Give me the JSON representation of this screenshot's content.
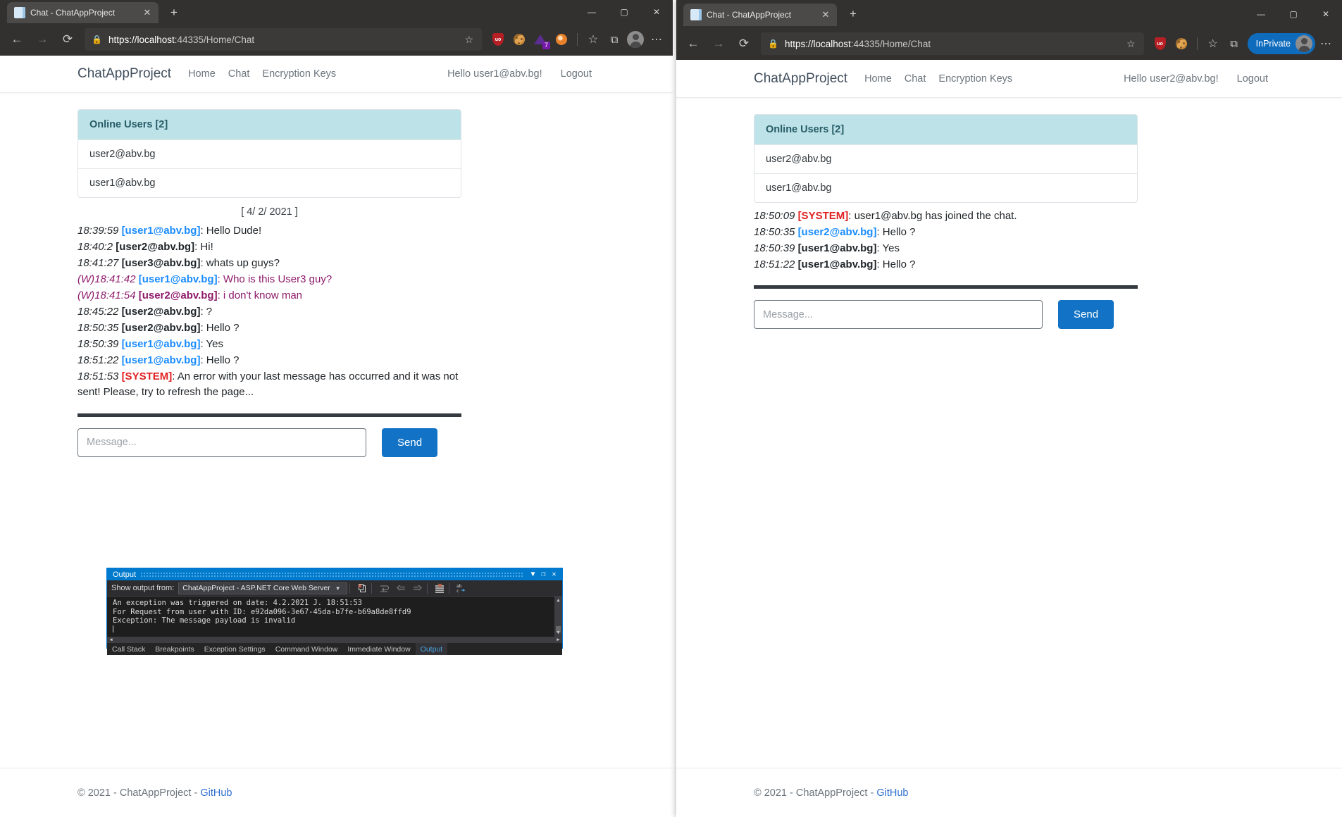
{
  "windows": {
    "left": {
      "tab_title": "Chat - ChatAppProject",
      "url_host": "https://localhost",
      "url_path": ":44335/Home/Chat",
      "extensions": [
        "ublock-shield-icon",
        "cookie-icon",
        "purple-extension-icon",
        "orange-extension-icon"
      ],
      "purple_badge": "7",
      "nav": {
        "brand": "ChatAppProject",
        "links": [
          "Home",
          "Chat",
          "Encryption Keys"
        ],
        "greeting": "Hello user1@abv.bg!",
        "logout": "Logout"
      },
      "online_users": {
        "header": "Online Users [2]",
        "rows": [
          "user2@abv.bg",
          "user1@abv.bg"
        ]
      },
      "datestamp": "[ 4/ 2/ 2021 ]",
      "messages": [
        {
          "prefix": "",
          "time": "18:39:59",
          "user": "[user1@abv.bg]",
          "text": ": Hello Dude!",
          "kind": "self"
        },
        {
          "prefix": "",
          "time": "18:40:2",
          "user": "[user2@abv.bg]",
          "text": ": Hi!",
          "kind": "other"
        },
        {
          "prefix": "",
          "time": "18:41:27",
          "user": "[user3@abv.bg]",
          "text": ": whats up guys?",
          "kind": "other"
        },
        {
          "prefix": "(W)",
          "time": "18:41:42",
          "user": "[user1@abv.bg]",
          "text": ": Who is this User3 guy?",
          "kind": "whisper-self"
        },
        {
          "prefix": "(W)",
          "time": "18:41:54",
          "user": "[user2@abv.bg]",
          "text": ": i don't know man",
          "kind": "whisper"
        },
        {
          "prefix": "",
          "time": "18:45:22",
          "user": "[user2@abv.bg]",
          "text": ": ?",
          "kind": "other"
        },
        {
          "prefix": "",
          "time": "18:50:35",
          "user": "[user2@abv.bg]",
          "text": ": Hello ?",
          "kind": "other"
        },
        {
          "prefix": "",
          "time": "18:50:39",
          "user": "[user1@abv.bg]",
          "text": ": Yes",
          "kind": "self"
        },
        {
          "prefix": "",
          "time": "18:51:22",
          "user": "[user1@abv.bg]",
          "text": ": Hello ?",
          "kind": "self"
        },
        {
          "prefix": "",
          "time": "18:51:53",
          "user": "[SYSTEM]",
          "text": ": An error with your last message has occurred and it was not sent! Please, try to refresh the page...",
          "kind": "system"
        }
      ],
      "composer": {
        "placeholder": "Message...",
        "value": "",
        "send_label": "Send"
      },
      "footer": {
        "copyright": "© 2021 - ChatAppProject - ",
        "link": "GitHub"
      }
    },
    "right": {
      "tab_title": "Chat - ChatAppProject",
      "url_host": "https://localhost",
      "url_path": ":44335/Home/Chat",
      "extensions": [
        "ublock-shield-icon",
        "cookie-icon"
      ],
      "inprivate_label": "InPrivate",
      "nav": {
        "brand": "ChatAppProject",
        "links": [
          "Home",
          "Chat",
          "Encryption Keys"
        ],
        "greeting": "Hello user2@abv.bg!",
        "logout": "Logout"
      },
      "online_users": {
        "header": "Online Users [2]",
        "rows": [
          "user2@abv.bg",
          "user1@abv.bg"
        ]
      },
      "messages": [
        {
          "prefix": "",
          "time": "18:50:09",
          "user": "[SYSTEM]",
          "text": ": user1@abv.bg has joined the chat.",
          "kind": "system"
        },
        {
          "prefix": "",
          "time": "18:50:35",
          "user": "[user2@abv.bg]",
          "text": ": Hello ?",
          "kind": "self"
        },
        {
          "prefix": "",
          "time": "18:50:39",
          "user": "[user1@abv.bg]",
          "text": ": Yes",
          "kind": "other"
        },
        {
          "prefix": "",
          "time": "18:51:22",
          "user": "[user1@abv.bg]",
          "text": ": Hello ?",
          "kind": "other"
        }
      ],
      "composer": {
        "placeholder": "Message...",
        "value": "",
        "send_label": "Send"
      },
      "footer": {
        "copyright": "© 2021 - ChatAppProject - ",
        "link": "GitHub"
      }
    }
  },
  "output_panel": {
    "title": "Output",
    "show_output_from_label": "Show output from:",
    "selected_source": "ChatAppProject - ASP.NET Core Web Server",
    "toolbar_icons": [
      "clear-all-icon",
      "toggle-wordwrap-icon",
      "navigate-back-icon",
      "navigate-forward-icon",
      "clear-pane-icon",
      "find-icon"
    ],
    "lines": [
      "An exception was triggered on date: 4.2.2021 J. 18:51:53",
      "For Request from user with ID: e92da096-3e67-45da-b7fe-b69a8de8ffd9",
      "Exception: The message payload is invalid"
    ],
    "tabs": [
      "Call Stack",
      "Breakpoints",
      "Exception Settings",
      "Command Window",
      "Immediate Window",
      "Output"
    ],
    "active_tab": "Output",
    "window_buttons": [
      "dropdown-chevron-icon",
      "maximize-icon",
      "close-icon"
    ]
  },
  "colors": {
    "accent_blue": "#1273c6",
    "system_red": "#e02020",
    "self_blue": "#1a8cff",
    "whisper_purple": "#8e1a6b",
    "users_header": "#bde3e8"
  }
}
